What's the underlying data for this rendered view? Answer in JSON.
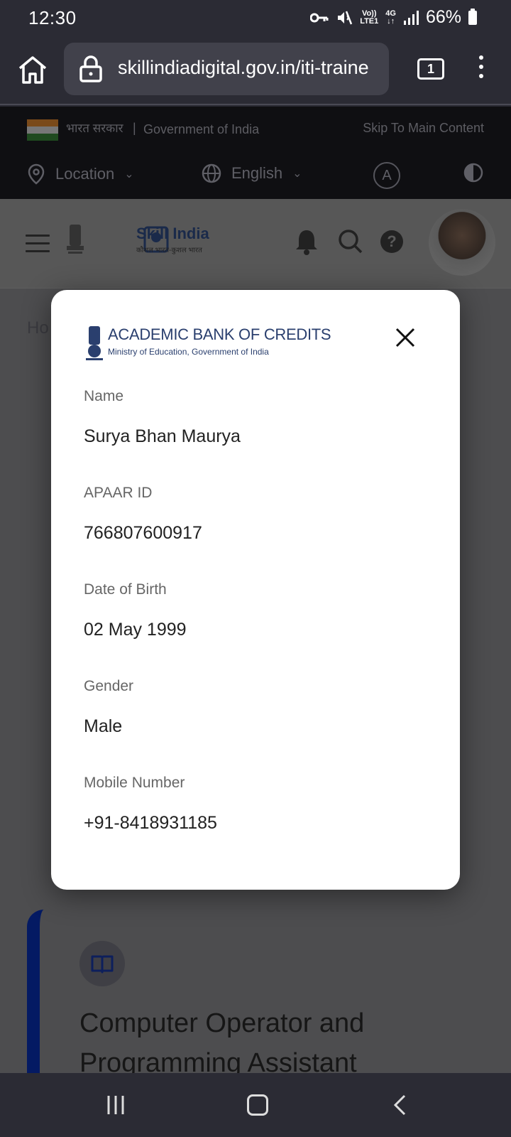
{
  "status_bar": {
    "time": "12:30",
    "net_top": "Vo))",
    "net_bottom": "LTE1",
    "net_type": "4G",
    "battery": "66%"
  },
  "browser": {
    "url": "skillindiadigital.gov.in/iti-traine",
    "tab_count": "1"
  },
  "gov_strip": {
    "hindi": "भारत सरकार",
    "separator": "|",
    "english": "Government of India",
    "skip": "Skip To Main Content",
    "location": "Location",
    "language": "English",
    "font_button": "A"
  },
  "site_header": {
    "brand": "Skill India",
    "brand_sub": "कौशल भारत-कुशल भारत",
    "help": "?"
  },
  "page": {
    "breadcrumb": "Ho",
    "course_title": "Computer Operator and Programming Assistant"
  },
  "modal": {
    "logo_title": "ACADEMIC BANK OF CREDITS",
    "logo_subtitle": "Ministry of Education, Government of India",
    "fields": [
      {
        "label": "Name",
        "value": "Surya Bhan Maurya"
      },
      {
        "label": "APAAR ID",
        "value": "766807600917"
      },
      {
        "label": "Date of Birth",
        "value": "02 May 1999"
      },
      {
        "label": "Gender",
        "value": "Male"
      },
      {
        "label": "Mobile Number",
        "value": "+91-8418931185"
      }
    ]
  },
  "colors": {
    "modal_bg": "#ffffff",
    "overlay": "#4d4d4f",
    "accent_navy": "#041a63",
    "abc_blue": "#2a3f6e"
  }
}
